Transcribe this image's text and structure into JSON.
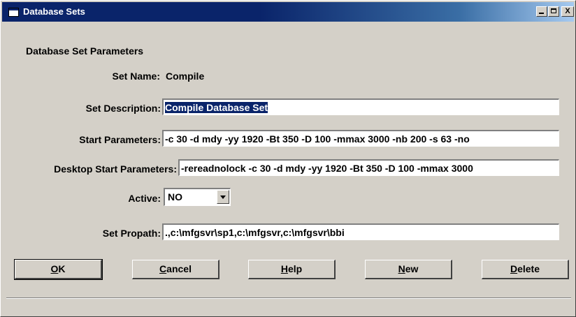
{
  "window": {
    "title": "Database Sets",
    "controls": {
      "minimize": "_",
      "maximize": "□",
      "close": "X"
    }
  },
  "form": {
    "section_title": "Database Set Parameters",
    "set_name_label": "Set Name:",
    "set_name_value": "Compile",
    "set_description_label": "Set Description:",
    "set_description_value": "Compile Database Set",
    "start_parameters_label": "Start Parameters:",
    "start_parameters_value": "-c 30 -d mdy -yy 1920 -Bt 350 -D 100 -mmax 3000 -nb 200 -s 63 -no",
    "desktop_start_parameters_label": "Desktop Start Parameters:",
    "desktop_start_parameters_value": "-rereadnolock -c 30 -d mdy -yy 1920 -Bt 350 -D 100 -mmax 3000",
    "active_label": "Active:",
    "active_value": "NO",
    "set_propath_label": "Set Propath:",
    "set_propath_value": ".,c:\\mfgsvr\\sp1,c:\\mfgsvr,c:\\mfgsvr\\bbi"
  },
  "buttons": {
    "ok": {
      "mnemonic": "O",
      "rest": "K"
    },
    "cancel": {
      "mnemonic": "C",
      "rest": "ancel"
    },
    "help": {
      "mnemonic": "H",
      "rest": "elp"
    },
    "new": {
      "mnemonic": "N",
      "rest": "ew"
    },
    "delete": {
      "mnemonic": "D",
      "rest": "elete"
    }
  }
}
